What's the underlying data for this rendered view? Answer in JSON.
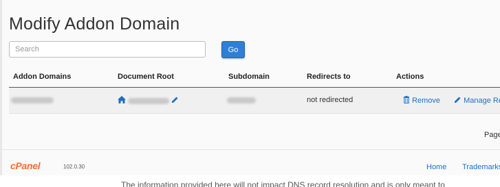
{
  "page": {
    "title": "Modify Addon Domain"
  },
  "search": {
    "placeholder": "Search",
    "value": "",
    "go_label": "Go"
  },
  "table": {
    "columns": [
      "Addon Domains",
      "Document Root",
      "Subdomain",
      "Redirects to",
      "Actions"
    ],
    "rows": [
      {
        "addon_domain": "",
        "document_root": "",
        "subdomain": "",
        "redirects_to": "not redirected",
        "actions": [
          "Remove",
          "Manage Re"
        ]
      }
    ]
  },
  "pagination": {
    "label": "Page"
  },
  "footer": {
    "logo": "cPanel",
    "version": "102.0.30",
    "links": [
      "Home",
      "Trademarks"
    ]
  },
  "notice": {
    "text": "The information provided here will not impact DNS record resolution and is only meant to"
  },
  "colors": {
    "accent": "#2f7fd4",
    "link": "#1f6fc2",
    "logo": "#ff6c2c"
  }
}
